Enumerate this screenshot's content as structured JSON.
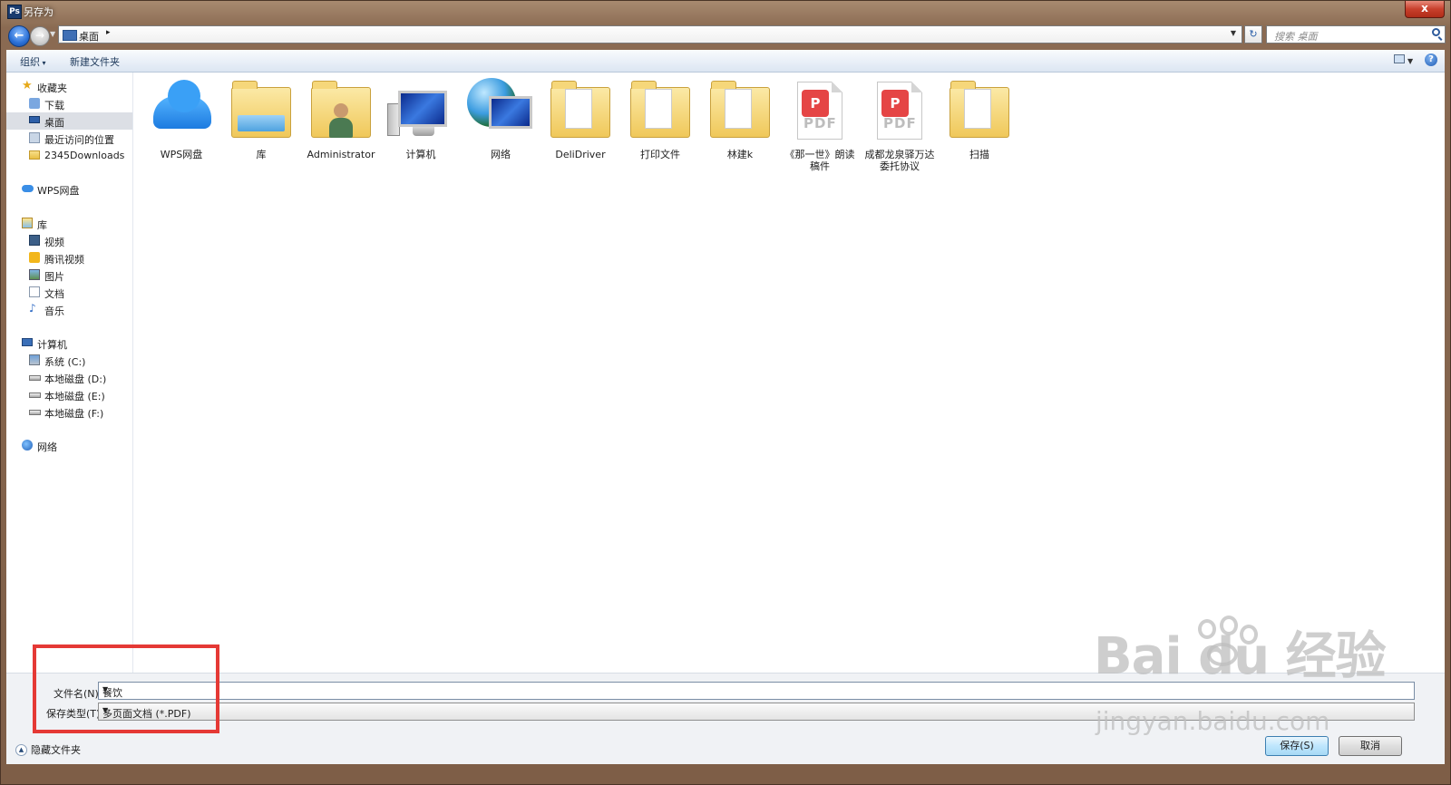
{
  "window": {
    "title": "另存为",
    "app_badge": "Ps",
    "close_label": "x"
  },
  "nav": {
    "back_label": "←",
    "address": "桌面",
    "address_sep": "▸",
    "search_placeholder": "搜索 桌面",
    "refresh_label": "↻"
  },
  "toolbar": {
    "organize": "组织",
    "new_folder": "新建文件夹",
    "help": "?"
  },
  "sidebar": {
    "favorites": {
      "label": "收藏夹",
      "items": [
        {
          "label": "下载"
        },
        {
          "label": "桌面"
        },
        {
          "label": "最近访问的位置"
        },
        {
          "label": "2345Downloads"
        }
      ]
    },
    "wps": {
      "label": "WPS网盘"
    },
    "library": {
      "label": "库",
      "items": [
        {
          "label": "视频"
        },
        {
          "label": "腾讯视频"
        },
        {
          "label": "图片"
        },
        {
          "label": "文档"
        },
        {
          "label": "音乐"
        }
      ]
    },
    "computer": {
      "label": "计算机",
      "items": [
        {
          "label": "系统 (C:)"
        },
        {
          "label": "本地磁盘 (D:)"
        },
        {
          "label": "本地磁盘 (E:)"
        },
        {
          "label": "本地磁盘 (F:)"
        }
      ]
    },
    "network": {
      "label": "网络"
    }
  },
  "files": [
    {
      "name": "WPS网盘",
      "icon": "cloud-icon"
    },
    {
      "name": "库",
      "icon": "library-icon"
    },
    {
      "name": "Administrator",
      "icon": "user-folder-icon"
    },
    {
      "name": "计算机",
      "icon": "computer-icon"
    },
    {
      "name": "网络",
      "icon": "network-icon"
    },
    {
      "name": "DeliDriver",
      "icon": "folder-icon"
    },
    {
      "name": "打印文件",
      "icon": "folder-icon"
    },
    {
      "name": "林建k",
      "icon": "folder-icon"
    },
    {
      "name": "《那一世》朗读稿件",
      "icon": "pdf-icon"
    },
    {
      "name": "成都龙泉驿万达委托协议",
      "icon": "pdf-icon"
    },
    {
      "name": "扫描",
      "icon": "folder-icon"
    }
  ],
  "pdf_label": "PDF",
  "save_form": {
    "filename_label": "文件名(N):",
    "filename_value": "餐饮",
    "filetype_label": "保存类型(T):",
    "filetype_value": "多页面文档 (*.PDF)"
  },
  "footer": {
    "hide_folders": "隐藏文件夹",
    "save": "保存(S)",
    "cancel": "取消"
  },
  "watermark": {
    "brand": "Bai  du 经验",
    "url": "jingyan.baidu.com"
  },
  "colors": {
    "highlight_box": "#e53935",
    "accent": "#2a6fd6"
  }
}
